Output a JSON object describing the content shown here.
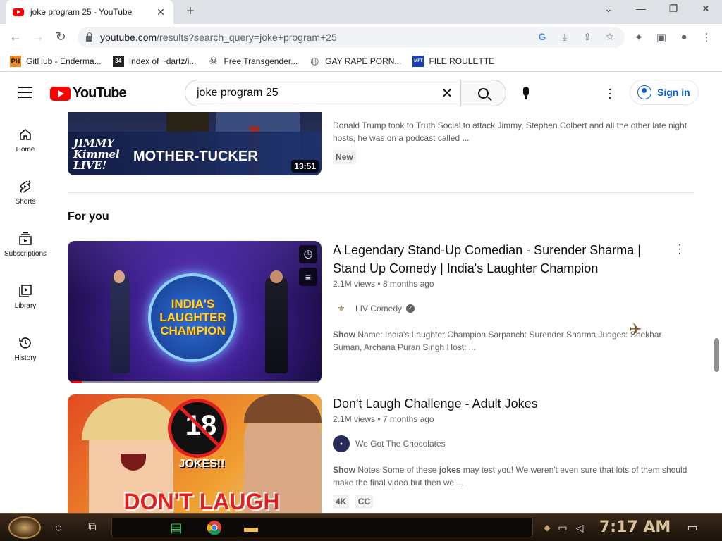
{
  "browser": {
    "tab_title": "joke program 25 - YouTube",
    "url_host": "youtube.com",
    "url_path": "/results?search_query=joke+program+25",
    "bookmarks": [
      {
        "label": "GitHub - Enderma...",
        "icon": "PH"
      },
      {
        "label": "Index of ~dartz/i...",
        "icon": "34"
      },
      {
        "label": "Free Transgender...",
        "icon": "skull"
      },
      {
        "label": "GAY RAPE PORN...",
        "icon": "globe"
      },
      {
        "label": "FILE ROULETTE",
        "icon": "MFT"
      }
    ]
  },
  "youtube": {
    "logo_text": "YouTube",
    "search_query": "joke program 25",
    "signin_label": "Sign in",
    "guide": [
      {
        "label": "Home",
        "icon": "home-icon"
      },
      {
        "label": "Shorts",
        "icon": "shorts-icon"
      },
      {
        "label": "Subscriptions",
        "icon": "subscriptions-icon"
      },
      {
        "label": "Library",
        "icon": "library-icon"
      },
      {
        "label": "History",
        "icon": "history-icon"
      }
    ]
  },
  "results": {
    "first": {
      "thumb_title": "MOTHER-TUCKER",
      "thumb_brand": "JIMMY Kimmel LIVE!",
      "duration": "13:51",
      "description": "Donald Trump took to Truth Social to attack Jimmy, Stephen Colbert and all the other late night hosts, he was on a podcast called ...",
      "badge": "New"
    },
    "section_title": "For you",
    "second": {
      "title": "A Legendary Stand-Up Comedian - Surender Sharma | Stand Up Comedy | India's Laughter Champion",
      "stats": "2.1M views • 8 months ago",
      "channel": "LIV Comedy",
      "thumb_text": "INDIA'S LAUGHTER CHAMPION",
      "desc_bold": "Show",
      "description": " Name: India's Laughter Champion Sarpanch: Surender Sharma Judges: Shekhar Suman, Archana Puran Singh Host: ..."
    },
    "third": {
      "title": "Don't Laugh Challenge - Adult Jokes",
      "stats": "2.1M views • 7 months ago",
      "channel": "We Got The Chocolates",
      "thumb_badge": "18",
      "thumb_jokes": "JOKES!!",
      "thumb_text": "DON'T LAUGH",
      "desc_bold_1": "Show",
      "desc_part_1": " Notes Some of these ",
      "desc_bold_2": "jokes",
      "desc_part_2": " may test you! We weren't even sure that lots of them should make the final video but then we ...",
      "badges": [
        "4K",
        "CC"
      ]
    }
  },
  "taskbar": {
    "clock": "7:17 AM"
  }
}
